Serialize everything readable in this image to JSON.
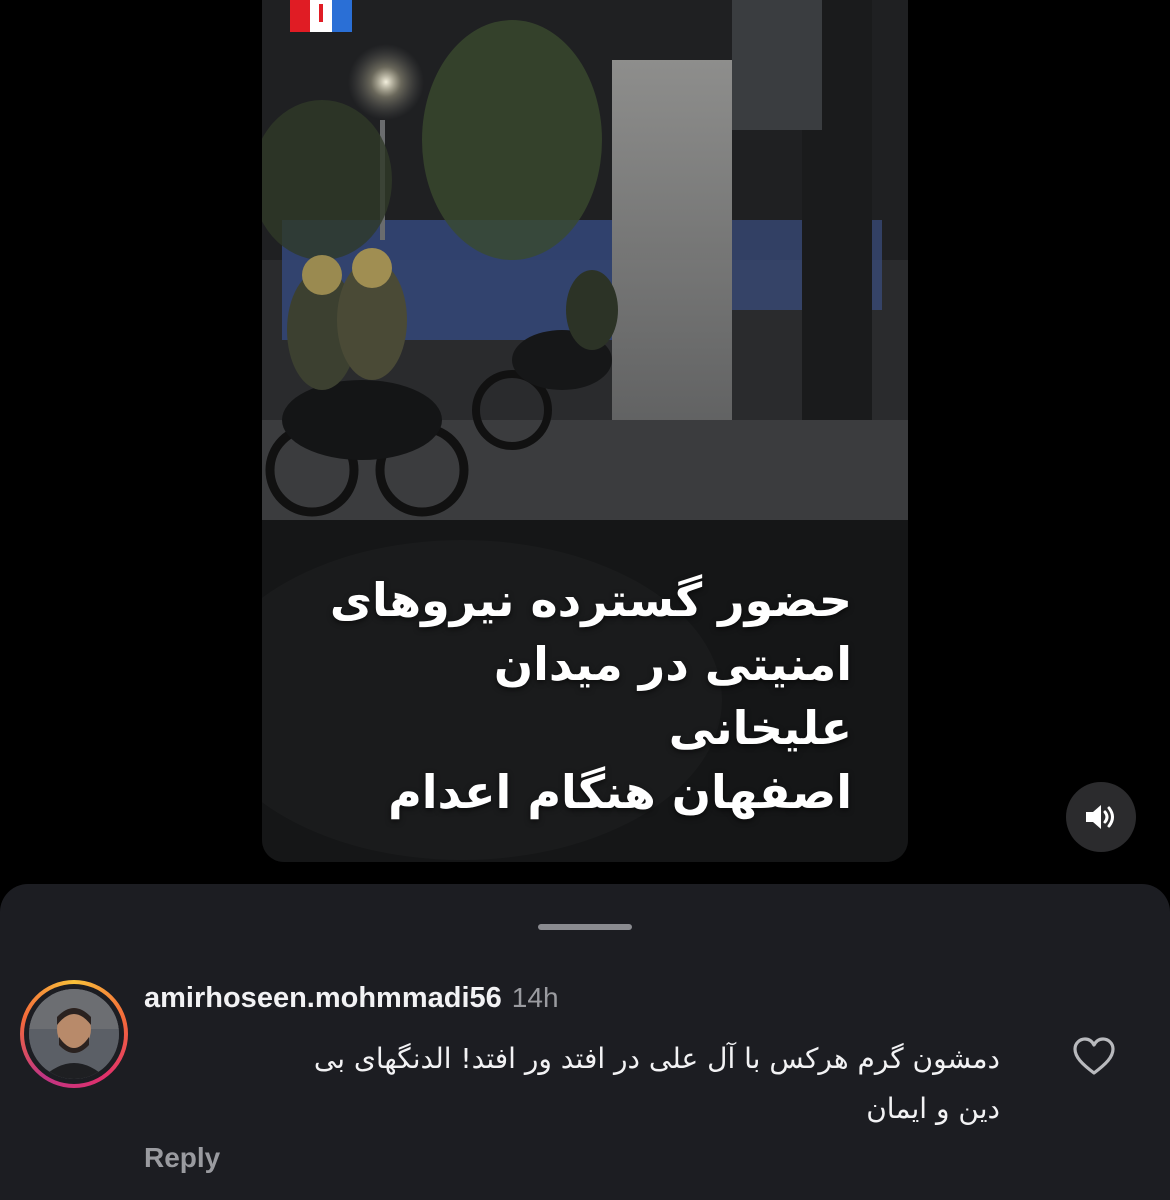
{
  "video": {
    "caption_lines": [
      "حضور گسترده نیروهای",
      "امنیتی در میدان علیخانی",
      "اصفهان هنگام اعدام"
    ],
    "logo_colors": [
      "#e01c24",
      "#ffffff",
      "#2a6fd6"
    ],
    "sound_icon": "speaker-icon"
  },
  "comment": {
    "username": "amirhoseen.mohmmadi56",
    "time": "14h",
    "text_line1": "دمشون گرم هرکس با آل علی در افتد ور افتد! الدنگهای بی",
    "text_line2": "دین و ایمان",
    "reply_label": "Reply",
    "like_icon": "heart-outline-icon"
  },
  "colors": {
    "sheet_background": "#1c1d22",
    "text_primary": "#f2f2f4",
    "text_secondary": "#9a9ba0"
  }
}
